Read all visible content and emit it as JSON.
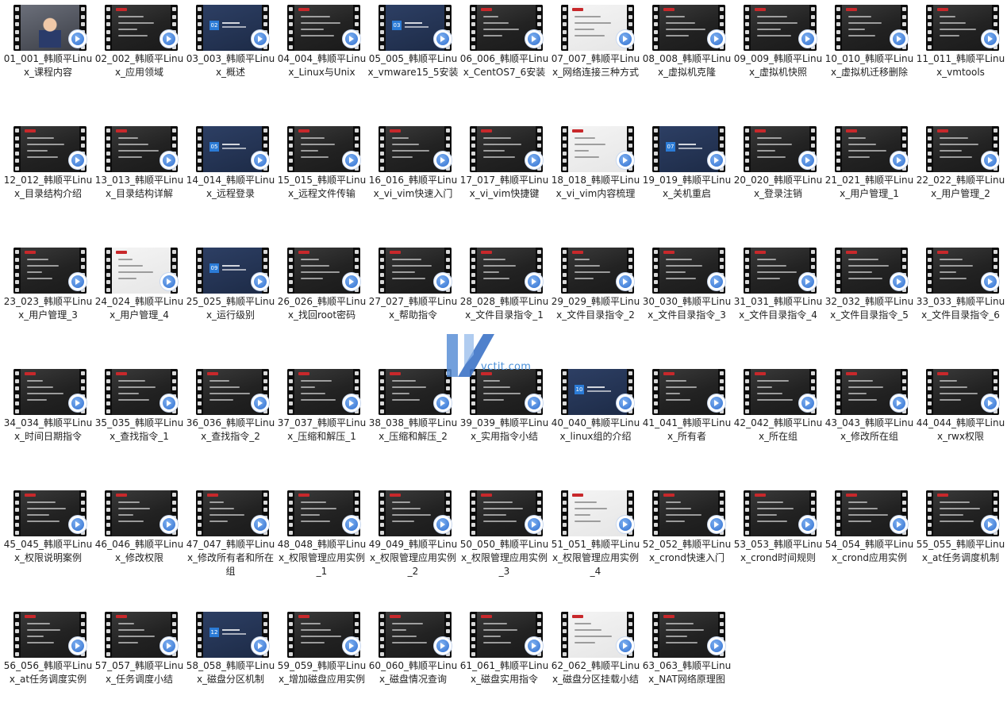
{
  "items": [
    {
      "label": "01_001_韩顺平Linux_课程内容",
      "style": "video"
    },
    {
      "label": "02_002_韩顺平Linux_应用领域",
      "style": "dark"
    },
    {
      "label": "03_003_韩顺平Linux_概述",
      "style": "chapter",
      "chapter": "02"
    },
    {
      "label": "04_004_韩顺平Linux_Linux与Unix",
      "style": "dark"
    },
    {
      "label": "05_005_韩顺平Linux_vmware15_5安装",
      "style": "chapter",
      "chapter": "03"
    },
    {
      "label": "06_006_韩顺平Linux_CentOS7_6安装",
      "style": "dark"
    },
    {
      "label": "07_007_韩顺平Linux_网络连接三种方式",
      "style": "light"
    },
    {
      "label": "08_008_韩顺平Linux_虚拟机克隆",
      "style": "dark"
    },
    {
      "label": "09_009_韩顺平Linux_虚拟机快照",
      "style": "dark"
    },
    {
      "label": "10_010_韩顺平Linux_虚拟机迁移删除",
      "style": "dark"
    },
    {
      "label": "11_011_韩顺平Linux_vmtools",
      "style": "dark"
    },
    {
      "label": "12_012_韩顺平Linux_目录结构介绍",
      "style": "dark"
    },
    {
      "label": "13_013_韩顺平Linux_目录结构详解",
      "style": "dark"
    },
    {
      "label": "14_014_韩顺平Linux_远程登录",
      "style": "chapter",
      "chapter": "05"
    },
    {
      "label": "15_015_韩顺平Linux_远程文件传输",
      "style": "dark"
    },
    {
      "label": "16_016_韩顺平Linux_vi_vim快速入门",
      "style": "dark"
    },
    {
      "label": "17_017_韩顺平Linux_vi_vim快捷键",
      "style": "dark"
    },
    {
      "label": "18_018_韩顺平Linux_vi_vim内容梳理",
      "style": "light"
    },
    {
      "label": "19_019_韩顺平Linux_关机重启",
      "style": "chapter",
      "chapter": "07"
    },
    {
      "label": "20_020_韩顺平Linux_登录注销",
      "style": "dark"
    },
    {
      "label": "21_021_韩顺平Linux_用户管理_1",
      "style": "dark"
    },
    {
      "label": "22_022_韩顺平Linux_用户管理_2",
      "style": "dark"
    },
    {
      "label": "23_023_韩顺平Linux_用户管理_3",
      "style": "dark"
    },
    {
      "label": "24_024_韩顺平Linux_用户管理_4",
      "style": "light"
    },
    {
      "label": "25_025_韩顺平Linux_运行级别",
      "style": "chapter",
      "chapter": "09"
    },
    {
      "label": "26_026_韩顺平Linux_找回root密码",
      "style": "dark"
    },
    {
      "label": "27_027_韩顺平Linux_帮助指令",
      "style": "dark"
    },
    {
      "label": "28_028_韩顺平Linux_文件目录指令_1",
      "style": "dark"
    },
    {
      "label": "29_029_韩顺平Linux_文件目录指令_2",
      "style": "dark"
    },
    {
      "label": "30_030_韩顺平Linux_文件目录指令_3",
      "style": "dark"
    },
    {
      "label": "31_031_韩顺平Linux_文件目录指令_4",
      "style": "dark"
    },
    {
      "label": "32_032_韩顺平Linux_文件目录指令_5",
      "style": "dark"
    },
    {
      "label": "33_033_韩顺平Linux_文件目录指令_6",
      "style": "dark"
    },
    {
      "label": "34_034_韩顺平Linux_时间日期指令",
      "style": "dark"
    },
    {
      "label": "35_035_韩顺平Linux_查找指令_1",
      "style": "dark"
    },
    {
      "label": "36_036_韩顺平Linux_查找指令_2",
      "style": "dark"
    },
    {
      "label": "37_037_韩顺平Linux_压缩和解压_1",
      "style": "dark"
    },
    {
      "label": "38_038_韩顺平Linux_压缩和解压_2",
      "style": "dark"
    },
    {
      "label": "39_039_韩顺平Linux_实用指令小结",
      "style": "dark"
    },
    {
      "label": "40_040_韩顺平Linux_linux组的介绍",
      "style": "chapter",
      "chapter": "10"
    },
    {
      "label": "41_041_韩顺平Linux_所有者",
      "style": "dark"
    },
    {
      "label": "42_042_韩顺平Linux_所在组",
      "style": "dark"
    },
    {
      "label": "43_043_韩顺平Linux_修改所在组",
      "style": "dark"
    },
    {
      "label": "44_044_韩顺平Linux_rwx权限",
      "style": "dark"
    },
    {
      "label": "45_045_韩顺平Linux_权限说明案例",
      "style": "dark"
    },
    {
      "label": "46_046_韩顺平Linux_修改权限",
      "style": "dark"
    },
    {
      "label": "47_047_韩顺平Linux_修改所有者和所在组",
      "style": "dark"
    },
    {
      "label": "48_048_韩顺平Linux_权限管理应用实例_1",
      "style": "dark"
    },
    {
      "label": "49_049_韩顺平Linux_权限管理应用实例_2",
      "style": "dark"
    },
    {
      "label": "50_050_韩顺平Linux_权限管理应用实例_3",
      "style": "dark"
    },
    {
      "label": "51_051_韩顺平Linux_权限管理应用实例_4",
      "style": "light"
    },
    {
      "label": "52_052_韩顺平Linux_crond快速入门",
      "style": "dark"
    },
    {
      "label": "53_053_韩顺平Linux_crond时间规则",
      "style": "dark"
    },
    {
      "label": "54_054_韩顺平Linux_crond应用实例",
      "style": "dark"
    },
    {
      "label": "55_055_韩顺平Linux_at任务调度机制",
      "style": "dark"
    },
    {
      "label": "56_056_韩顺平Linux_at任务调度实例",
      "style": "dark"
    },
    {
      "label": "57_057_韩顺平Linux_任务调度小结",
      "style": "dark"
    },
    {
      "label": "58_058_韩顺平Linux_磁盘分区机制",
      "style": "chapter",
      "chapter": "12"
    },
    {
      "label": "59_059_韩顺平Linux_增加磁盘应用实例",
      "style": "dark"
    },
    {
      "label": "60_060_韩顺平Linux_磁盘情况查询",
      "style": "dark"
    },
    {
      "label": "61_061_韩顺平Linux_磁盘实用指令",
      "style": "dark"
    },
    {
      "label": "62_062_韩顺平Linux_磁盘分区挂载小结",
      "style": "light"
    },
    {
      "label": "63_063_韩顺平Linux_NAT网络原理图",
      "style": "dark"
    }
  ],
  "watermark": {
    "text": "vctit.com",
    "color": "#4a90d9"
  },
  "colors": {
    "accent": "#2b7bd6",
    "tag": "#c8282b",
    "badge": "#2f6fd0"
  },
  "icons": {
    "play_badge": "play-badge-icon"
  }
}
